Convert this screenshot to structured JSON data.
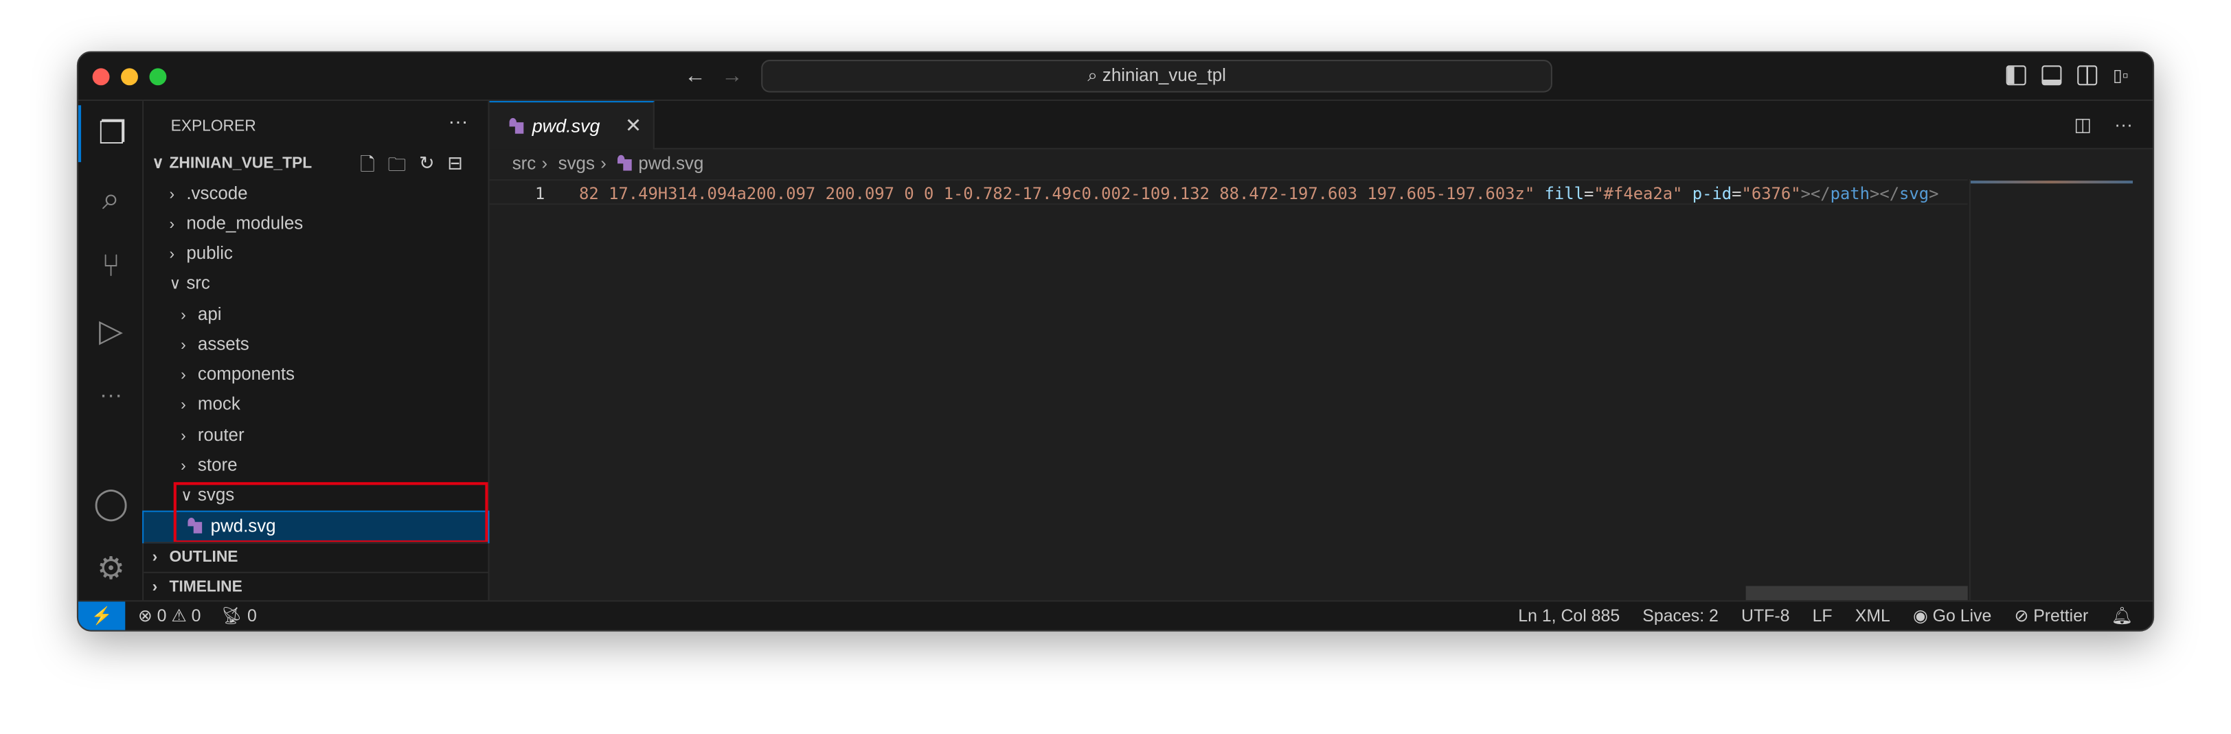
{
  "window": {
    "title": "zhinian_vue_tpl"
  },
  "colors": {
    "accent": "#0078d4",
    "string": "#ce9178",
    "attr": "#9cdcfe",
    "tag": "#569cd6",
    "highlight_box": "#e00012"
  },
  "sidebar": {
    "title": "EXPLORER",
    "root": "ZHINIAN_VUE_TPL",
    "tree": [
      {
        "label": ".vscode",
        "expanded": false
      },
      {
        "label": "node_modules",
        "expanded": false
      },
      {
        "label": "public",
        "expanded": false
      },
      {
        "label": "src",
        "expanded": true
      },
      {
        "label": "api",
        "expanded": false
      },
      {
        "label": "assets",
        "expanded": false
      },
      {
        "label": "components",
        "expanded": false
      },
      {
        "label": "mock",
        "expanded": false
      },
      {
        "label": "router",
        "expanded": false
      },
      {
        "label": "store",
        "expanded": false
      },
      {
        "label": "svgs",
        "expanded": true
      },
      {
        "label": "pwd.svg",
        "selected": true
      }
    ],
    "outline": "OUTLINE",
    "timeline": "TIMELINE"
  },
  "editor": {
    "tab": "pwd.svg",
    "breadcrumb": [
      "src",
      "svgs",
      "pwd.svg"
    ],
    "line_number": "1",
    "code": {
      "path_value": "82 17.49H314.094a200.097 200.097 0 0 1-0.782-17.49c0.002-109.132 88.472-197.603 197.605-197.603z\"",
      "attr1": "fill",
      "val1": "\"#f4ea2a\"",
      "attr2": "p-id",
      "val2": "\"6376\"",
      "close1": "></",
      "tag1": "path",
      "close2": "></",
      "tag2": "svg",
      "close3": ">"
    }
  },
  "status": {
    "errors": "0",
    "warnings": "0",
    "ports": "0",
    "position": "Ln 1, Col 885",
    "spaces": "Spaces: 2",
    "encoding": "UTF-8",
    "eol": "LF",
    "language": "XML",
    "golive": "Go Live",
    "prettier": "Prettier"
  }
}
